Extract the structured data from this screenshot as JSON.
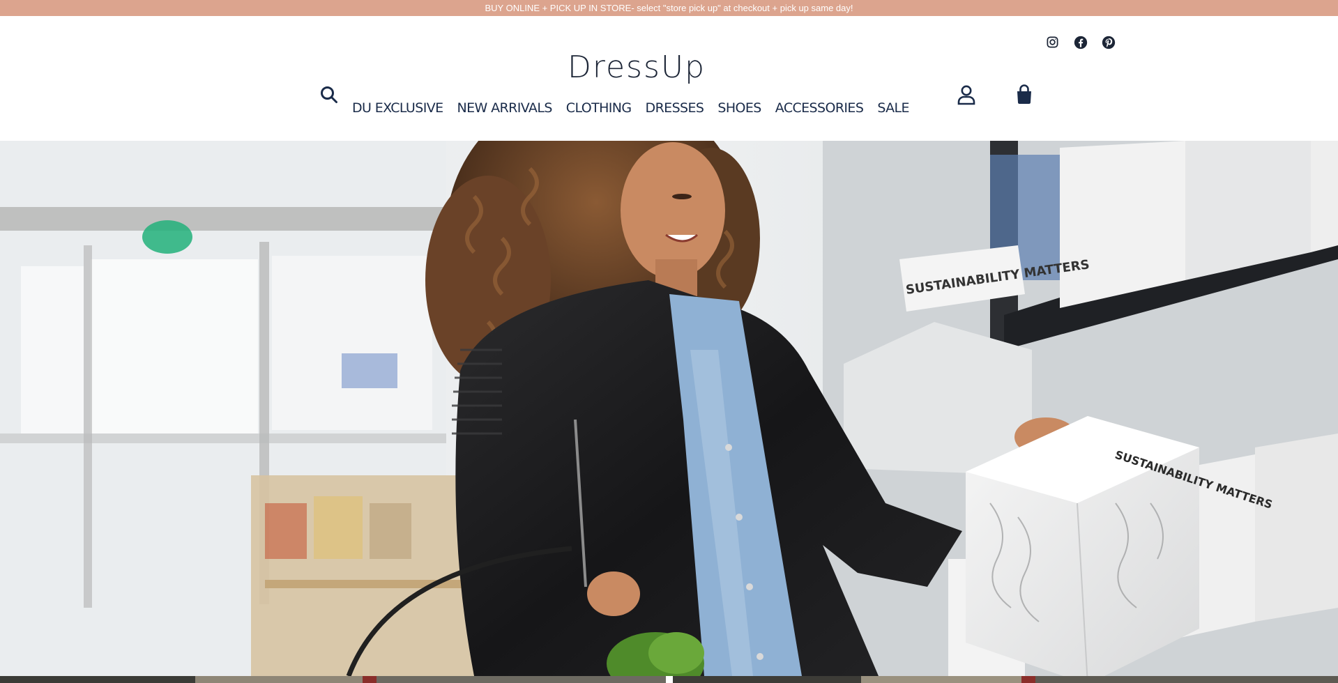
{
  "announcement": {
    "text": "BUY ONLINE + PICK UP IN STORE- select \"store pick up\" at checkout + pick up same day!",
    "bg_color": "#dca48e"
  },
  "social": [
    {
      "icon": "instagram-icon"
    },
    {
      "icon": "facebook-icon"
    },
    {
      "icon": "pinterest-icon"
    }
  ],
  "header": {
    "logo": "DressUp",
    "search_icon": "search-icon",
    "account_icon": "account-icon",
    "cart_icon": "shopping-bag-icon",
    "text_color": "#1a2b49"
  },
  "nav": {
    "items": [
      {
        "label": "DU EXCLUSIVE"
      },
      {
        "label": "NEW ARRIVALS"
      },
      {
        "label": "CLOTHING"
      },
      {
        "label": "DRESSES"
      },
      {
        "label": "SHOES"
      },
      {
        "label": "ACCESSORIES"
      },
      {
        "label": "SALE"
      }
    ]
  },
  "hero": {
    "image": "woman-shopping-photo",
    "package_text": "SUSTAINABILITY MATTERS",
    "shelf_sign_text": "SUSTAINABILITY MATTERS"
  }
}
